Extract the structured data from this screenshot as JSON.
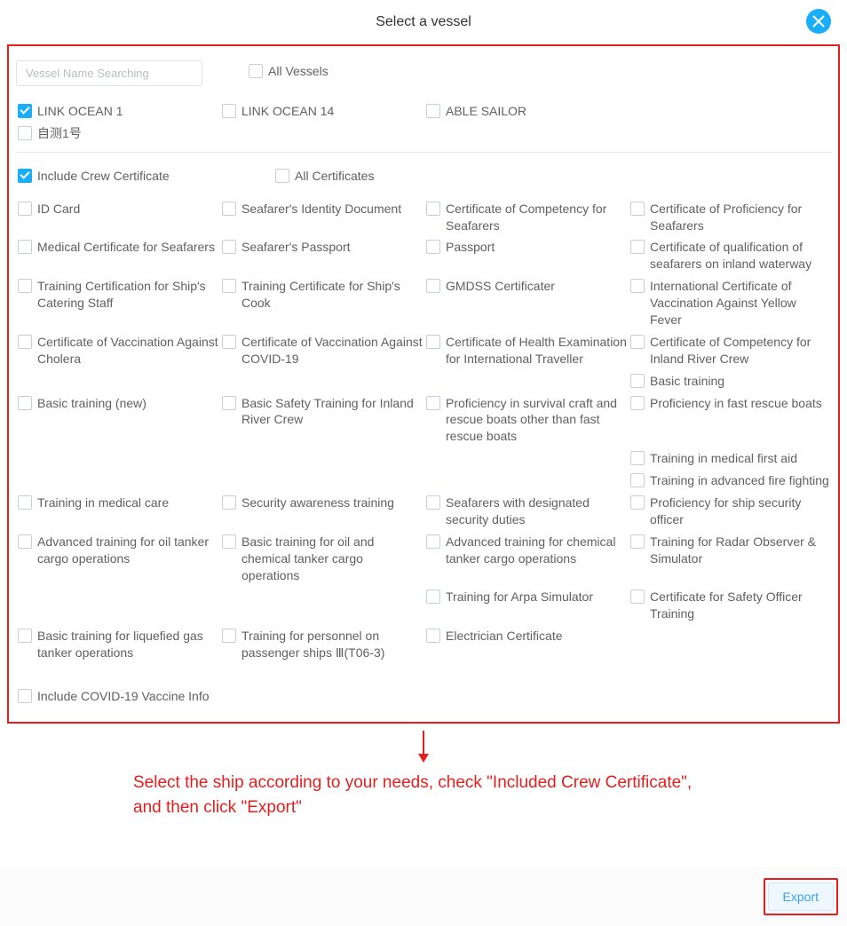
{
  "header": {
    "title": "Select a vessel"
  },
  "search": {
    "placeholder": "Vessel Name Searching"
  },
  "allVesselsLabel": "All Vessels",
  "vessels": [
    {
      "label": "LINK OCEAN 1",
      "checked": true
    },
    {
      "label": "LINK OCEAN 14",
      "checked": false
    },
    {
      "label": "ABLE SAILOR",
      "checked": false
    },
    {
      "label": "自测1号",
      "checked": false
    }
  ],
  "includeCrewCert": {
    "label": "Include Crew Certificate",
    "checked": true
  },
  "allCertsLabel": "All Certificates",
  "certificates": [
    {
      "label": "ID Card"
    },
    {
      "label": "Seafarer's Identity Document"
    },
    {
      "label": "Certificate of Competency for Seafarers"
    },
    {
      "label": "Certificate of Proficiency for Seafarers"
    },
    {
      "label": "Medical Certificate for Seafarers"
    },
    {
      "label": "Seafarer's Passport"
    },
    {
      "label": "Passport"
    },
    {
      "label": "Certificate of qualification of seafarers on inland waterway"
    },
    {
      "label": "Training Certification for Ship's Catering Staff"
    },
    {
      "label": "Training Certificate for Ship's Cook"
    },
    {
      "label": "GMDSS Certificater"
    },
    {
      "label": "International Certificate of Vaccination Against Yellow Fever"
    },
    {
      "label": "Certificate of Vaccination Against Cholera"
    },
    {
      "label": "Certificate of Vaccination Against COVID-19"
    },
    {
      "label": "Certificate of Health Examination for International Traveller"
    },
    {
      "label": "Certificate of Competency for Inland River Crew"
    },
    {
      "label": ""
    },
    {
      "label": ""
    },
    {
      "label": ""
    },
    {
      "label": "Basic training"
    },
    {
      "label": "Basic training (new)"
    },
    {
      "label": "Basic Safety Training for Inland River Crew"
    },
    {
      "label": "Proficiency in survival craft and rescue boats other than fast rescue boats"
    },
    {
      "label": "Proficiency in fast rescue boats"
    },
    {
      "label": ""
    },
    {
      "label": ""
    },
    {
      "label": ""
    },
    {
      "label": "Training in medical first aid"
    },
    {
      "label": ""
    },
    {
      "label": ""
    },
    {
      "label": ""
    },
    {
      "label": "Training in advanced fire fighting"
    },
    {
      "label": "Training in medical care"
    },
    {
      "label": "Security awareness training"
    },
    {
      "label": "Seafarers with designated security duties"
    },
    {
      "label": "Proficiency for ship security officer"
    },
    {
      "label": "Advanced training for oil tanker cargo operations"
    },
    {
      "label": "Basic training for oil and chemical tanker cargo operations"
    },
    {
      "label": "Advanced training for chemical tanker cargo operations"
    },
    {
      "label": "Training for Radar Observer & Simulator"
    },
    {
      "label": ""
    },
    {
      "label": ""
    },
    {
      "label": "Training for Arpa Simulator"
    },
    {
      "label": "Certificate for Safety Officer Training"
    },
    {
      "label": "Basic training for liquefied gas tanker operations"
    },
    {
      "label": "Training for personnel on passenger ships Ⅲ(T06-3)"
    },
    {
      "label": "Electrician Certificate"
    },
    {
      "label": ""
    }
  ],
  "includeCovid": {
    "label": "Include COVID-19 Vaccine Info",
    "checked": false
  },
  "instruction": "Select  the ship according to your needs, check \"Included  Crew Certificate\", and then click \"Export\"",
  "footer": {
    "exportLabel": "Export"
  },
  "colors": {
    "accent": "#1aaef8",
    "highlight": "#e81e1e"
  }
}
